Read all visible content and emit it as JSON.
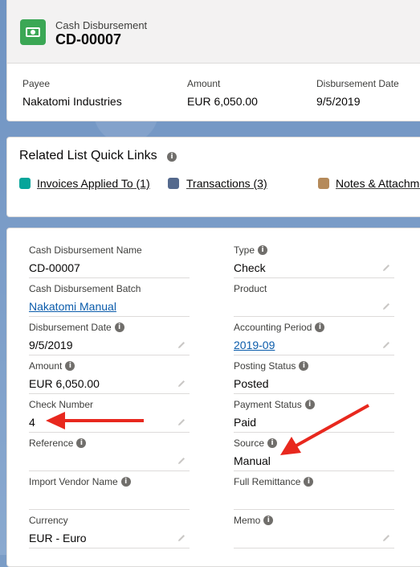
{
  "header": {
    "object_type": "Cash Disbursement",
    "record_name": "CD-00007",
    "fields": [
      {
        "label": "Payee",
        "value": "Nakatomi Industries"
      },
      {
        "label": "Amount",
        "value": "EUR 6,050.00"
      },
      {
        "label": "Disbursement Date",
        "value": "9/5/2019"
      }
    ]
  },
  "quick_links": {
    "title": "Related List Quick Links",
    "links": [
      {
        "label": "Invoices Applied To (1)",
        "icon": "invoice-icon",
        "color": "#06a59a"
      },
      {
        "label": "Transactions (3)",
        "icon": "wrench-icon",
        "color": "#54698d"
      },
      {
        "label": "Notes & Attachme",
        "icon": "note-icon",
        "color": "#b58a5a"
      }
    ]
  },
  "details": {
    "left": [
      {
        "label": "Cash Disbursement Name",
        "value": "CD-00007",
        "info": false,
        "link": false
      },
      {
        "label": "Cash Disbursement Batch",
        "value": "Nakatomi Manual",
        "info": false,
        "link": true
      },
      {
        "label": "Disbursement Date",
        "value": "9/5/2019",
        "info": true,
        "link": false
      },
      {
        "label": "Amount",
        "value": "EUR 6,050.00",
        "info": true,
        "link": false
      },
      {
        "label": "Check Number",
        "value": "4",
        "info": false,
        "link": false
      },
      {
        "label": "Reference",
        "value": "",
        "info": true,
        "link": false
      },
      {
        "label": "Import Vendor Name",
        "value": "",
        "info": true,
        "link": false
      },
      {
        "label": "Currency",
        "value": "EUR - Euro",
        "info": false,
        "link": false
      }
    ],
    "right": [
      {
        "label": "Type",
        "value": "Check",
        "info": true,
        "link": false
      },
      {
        "label": "Product",
        "value": "",
        "info": false,
        "link": false
      },
      {
        "label": "Accounting Period",
        "value": "2019-09",
        "info": true,
        "link": true
      },
      {
        "label": "Posting Status",
        "value": "Posted",
        "info": true,
        "link": false
      },
      {
        "label": "Payment Status",
        "value": "Paid",
        "info": true,
        "link": false
      },
      {
        "label": "Source",
        "value": "Manual",
        "info": true,
        "link": false
      },
      {
        "label": "Full Remittance",
        "value": "",
        "info": true,
        "link": false
      },
      {
        "label": "Memo",
        "value": "",
        "info": true,
        "link": false
      }
    ]
  },
  "colors": {
    "object_icon": "#3ba755",
    "link": "#0b5cab",
    "arrow": "#e8281e"
  }
}
